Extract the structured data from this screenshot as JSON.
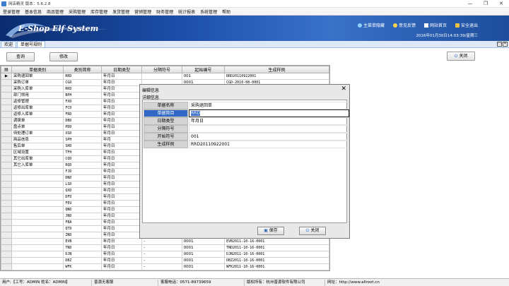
{
  "window": {
    "title": "网店精灵 版本：5.6.2.8",
    "controls": [
      "—",
      "❐",
      "✕"
    ]
  },
  "menu": [
    "登录管理",
    "基本信息",
    "商品管理",
    "采购管理",
    "库存管理",
    "发货管理",
    "营销管理",
    "财务管理",
    "统计报表",
    "系统管理",
    "帮助"
  ],
  "banner": {
    "logo_text": "E-Shop Elf System",
    "links": [
      "主菜单隐藏",
      "意见反馈",
      "网站首页",
      "安全退出"
    ],
    "datetime": "2016年01月30日14:03:39/星期三"
  },
  "tabs": [
    {
      "label": "欢迎",
      "active": false
    },
    {
      "label": "单据号规则",
      "active": true
    }
  ],
  "toolbar": {
    "query_label": "查询",
    "edit_label": "修改",
    "close_label": "关闭"
  },
  "grid": {
    "columns": [
      "单据类别",
      "类别简称",
      "日期类型",
      "分隔符号",
      "起始编号",
      "生成样例"
    ],
    "rows": [
      [
        "采购退回单",
        "RRD",
        "年月日",
        "",
        "001",
        "RRD20110922001"
      ],
      [
        "采购订单",
        "CGD",
        "年月日",
        "",
        "0001",
        "CGD-2010-08-0001"
      ],
      [
        "采购入库单",
        "RKD",
        "年月日",
        "",
        "",
        ""
      ],
      [
        "部门领用",
        "BPH",
        "年月日",
        "",
        "",
        ""
      ],
      [
        "返修管理",
        "FXD",
        "年月日",
        "",
        "",
        ""
      ],
      [
        "返修出库单",
        "FCD",
        "年月日",
        "",
        "",
        ""
      ],
      [
        "返修入库单",
        "FRD",
        "年月日",
        "",
        "",
        ""
      ],
      [
        "调拨单",
        "DBD",
        "年月日",
        "",
        "",
        ""
      ],
      [
        "盘点单",
        "PDD",
        "年月日",
        "",
        "",
        ""
      ],
      [
        "待处理订单",
        "XSD",
        "年月日",
        "",
        "",
        ""
      ],
      [
        "商品信息",
        "SPH",
        "年月",
        "",
        "",
        ""
      ],
      [
        "售后单",
        "SHD",
        "年月日",
        "",
        "",
        ""
      ],
      [
        "区域设置",
        "TFH",
        "年月日",
        "",
        "",
        ""
      ],
      [
        "其它出库单",
        "CQD",
        "年月日",
        "",
        "",
        ""
      ],
      [
        "其它入库单",
        "RQD",
        "年月日",
        "",
        "",
        ""
      ],
      [
        "",
        "FJD",
        "年月日",
        "",
        "",
        ""
      ],
      [
        "",
        "DND",
        "年月日",
        "",
        "",
        ""
      ],
      [
        "",
        "LSD",
        "年月日",
        "",
        "",
        ""
      ],
      [
        "",
        "QXD",
        "年月日",
        "",
        "",
        ""
      ],
      [
        "",
        "DFD",
        "年月日",
        "",
        "",
        ""
      ],
      [
        "",
        "FEU",
        "年月日",
        "",
        "",
        ""
      ],
      [
        "",
        "QND",
        "年月日",
        "",
        "",
        ""
      ],
      [
        "",
        "JND",
        "年月日",
        "",
        "",
        ""
      ],
      [
        "",
        "FBA",
        "年月日",
        "",
        "",
        ""
      ],
      [
        "",
        "QTD",
        "年月日",
        "",
        "",
        ""
      ],
      [
        "",
        "ZND",
        "年月日",
        "",
        "",
        ""
      ],
      [
        "",
        "EVB",
        "年月日",
        "-",
        "0001",
        "EVB2011-10-16-0001"
      ],
      [
        "",
        "TND",
        "年月日",
        "-",
        "0001",
        "TND2011-10-16-0001"
      ],
      [
        "",
        "DJN",
        "年月日",
        "-",
        "0001",
        "DJN2011-10-16-0001"
      ],
      [
        "",
        "DBZ",
        "年月日",
        "-",
        "0001",
        "DBZ2011-10-16-0001"
      ],
      [
        "",
        "WFK",
        "年月日",
        "-",
        "0001",
        "WFK2011-10-16-0001"
      ]
    ]
  },
  "dialog": {
    "title": "编辑信息",
    "subtitle": "详细信息",
    "close_glyph": "✕",
    "fields": [
      {
        "label": "单据名称",
        "value": "采购退回单"
      },
      {
        "label": "单据简目",
        "value": "RRD"
      },
      {
        "label": "日期类型",
        "value": "年月日"
      },
      {
        "label": "分隔符号",
        "value": ""
      },
      {
        "label": "开始符号",
        "value": "001"
      },
      {
        "label": "生成样例",
        "value": "RRD20110922001"
      }
    ],
    "save_label": "保存",
    "close_label": "关闭"
  },
  "status": {
    "user": "用户:【工号：ADMIN  姓名：ADMIN】",
    "customer": "普源无客服",
    "phone": "客服电话：0571-89739659",
    "copyright": "版权所有：杭州普源软件有限公司",
    "website": "网址：http://www.allroot.cn"
  },
  "colors": {
    "banner": "#1c4ea8",
    "selection": "#3168c6",
    "tab_border": "#99bbe8"
  }
}
